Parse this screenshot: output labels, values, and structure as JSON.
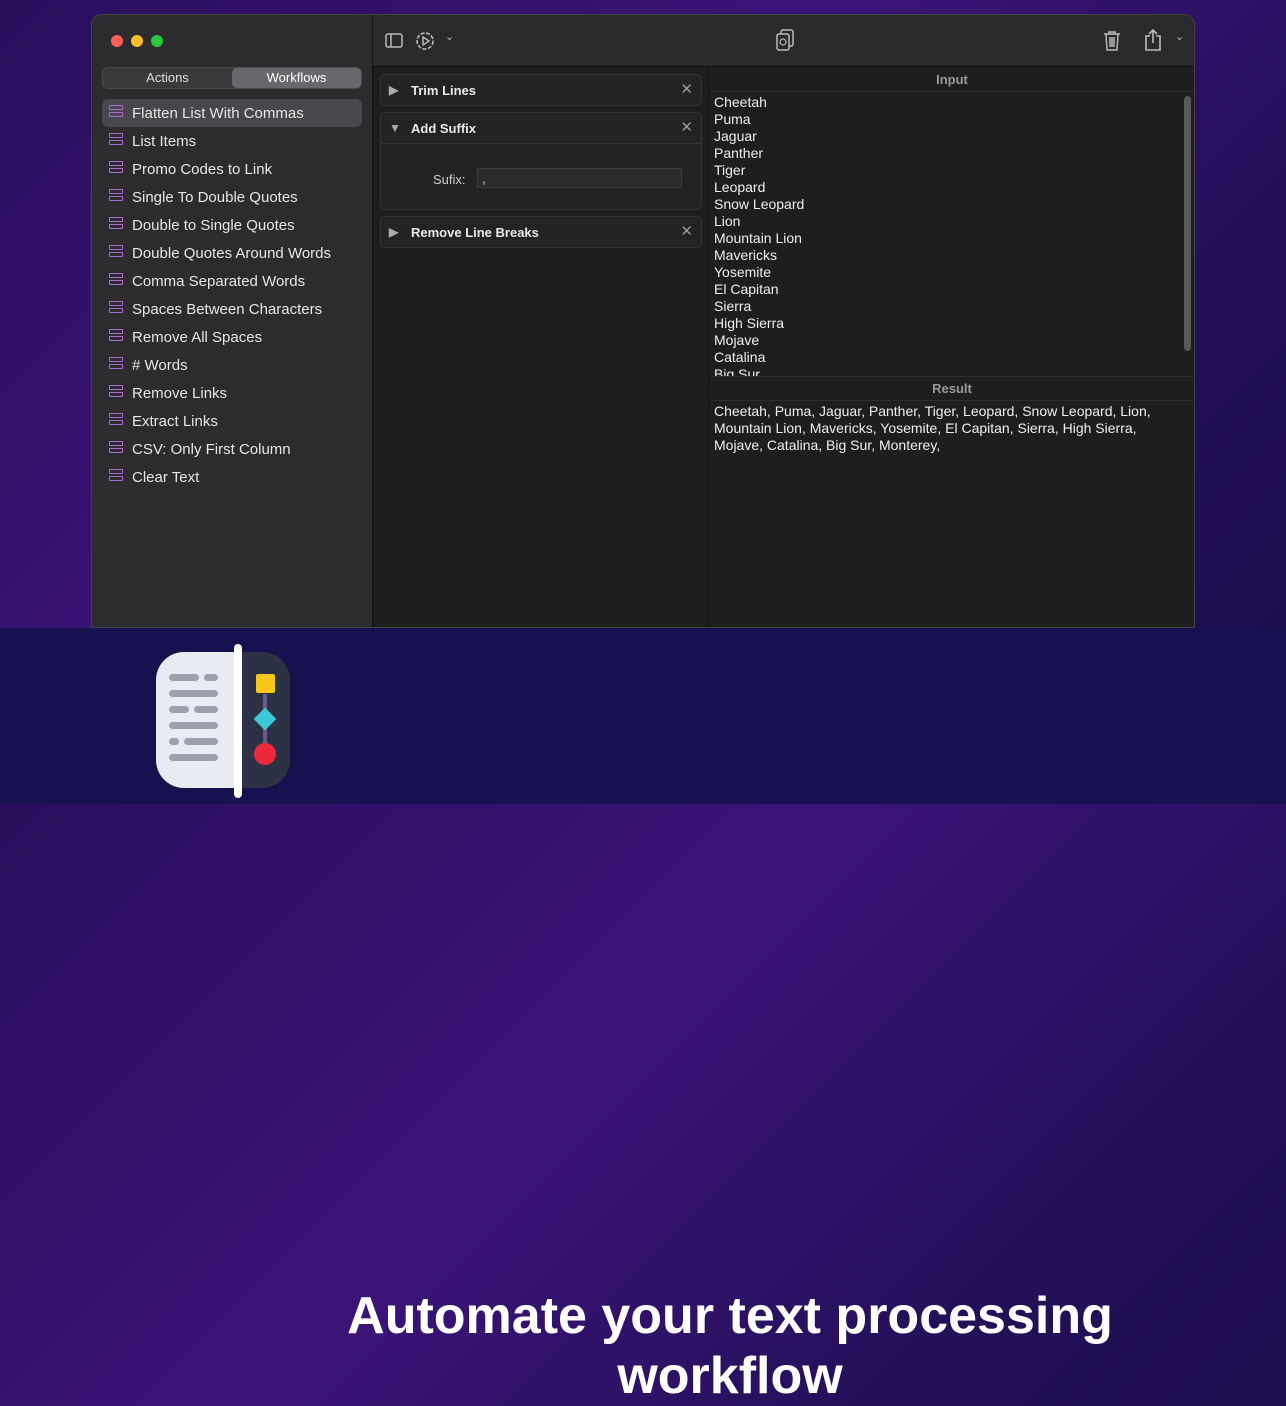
{
  "sidebar": {
    "tabs": [
      {
        "label": "Actions"
      },
      {
        "label": "Workflows"
      }
    ],
    "items": [
      "Flatten List With Commas",
      "List Items",
      "Promo Codes to Link",
      "Single To Double Quotes",
      "Double to Single Quotes",
      "Double Quotes Around Words",
      "Comma Separated Words",
      "Spaces Between Characters",
      "Remove All Spaces",
      "# Words",
      "Remove Links",
      "Extract Links",
      "CSV: Only First Column",
      "Clear Text"
    ]
  },
  "actions": [
    {
      "title": "Trim Lines",
      "expanded": false
    },
    {
      "title": "Add Suffix",
      "expanded": true,
      "field_label": "Sufix:",
      "field_value": ","
    },
    {
      "title": "Remove Line Breaks",
      "expanded": false
    }
  ],
  "input": {
    "title": "Input",
    "lines": [
      "Cheetah",
      "Puma",
      "Jaguar",
      "Panther",
      "Tiger",
      "Leopard",
      "Snow Leopard",
      "Lion",
      "Mountain Lion",
      "Mavericks",
      "Yosemite",
      "El Capitan",
      "Sierra",
      "High Sierra",
      "Mojave",
      "Catalina",
      "Big Sur"
    ]
  },
  "result": {
    "title": "Result",
    "text": "Cheetah, Puma, Jaguar, Panther, Tiger, Leopard, Snow Leopard, Lion, Mountain Lion, Mavericks, Yosemite, El Capitan, Sierra, High Sierra, Mojave, Catalina, Big Sur, Monterey,"
  },
  "banner": {
    "headline": "Automate your text processing workflow"
  },
  "colors": {
    "accent": "#b06ad0",
    "banner": "#15124f"
  }
}
